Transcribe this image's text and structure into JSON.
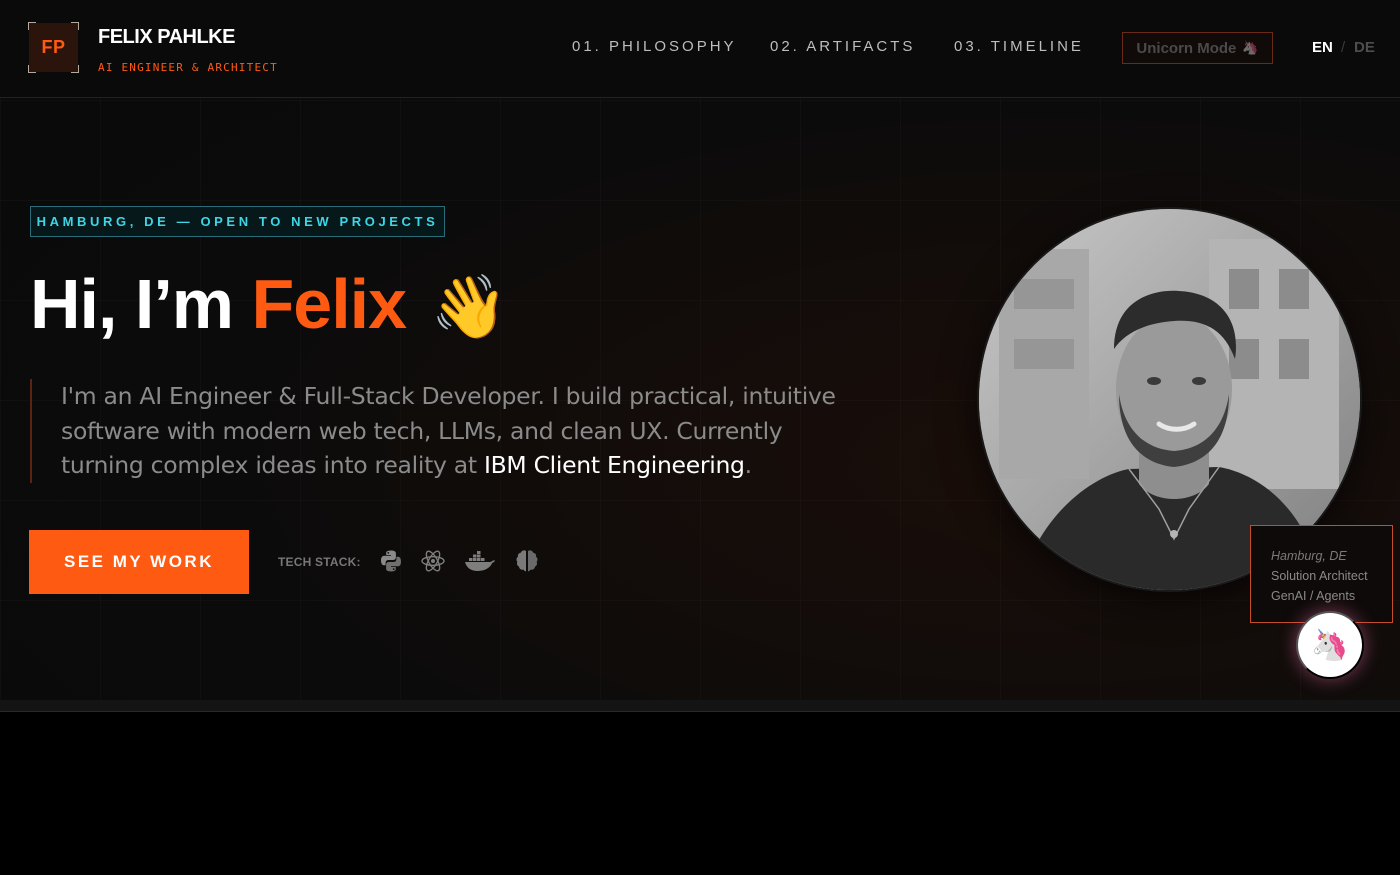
{
  "header": {
    "logo_initials": "FP",
    "brand_name": "FELIX PAHLKE",
    "brand_subtitle": "AI ENGINEER & ARCHITECT",
    "nav": [
      {
        "label": "01. PHILOSOPHY"
      },
      {
        "label": "02. ARTIFACTS"
      },
      {
        "label": "03. TIMELINE"
      }
    ],
    "unicorn_toggle": {
      "label": "Unicorn Mode",
      "icon": "unicorn-icon"
    },
    "languages": {
      "active": "EN",
      "separator": "/",
      "other": "DE"
    }
  },
  "hero": {
    "status_badge": "HAMBURG, DE — OPEN TO NEW PROJECTS",
    "greeting": "Hi, I’m",
    "name": "Felix",
    "wave_emoji": "👋",
    "intro_text": "I'm an AI Engineer & Full-Stack Developer. I build practical, intuitive software with modern web tech, LLMs, and clean UX. Currently turning complex ideas into reality at",
    "intro_highlight": "IBM Client Engineering",
    "intro_end": ".",
    "cta_label": "SEE MY WORK",
    "tech_stack_label": "TECH STACK:",
    "tech_stack_icons": [
      "python-icon",
      "react-icon",
      "docker-icon",
      "brain-icon"
    ]
  },
  "profile_card": {
    "location": "Hamburg, DE",
    "role": "Solution Architect",
    "focus": "GenAI / Agents"
  },
  "floating_button": {
    "emoji": "🦄",
    "icon": "unicorn-icon"
  },
  "colors": {
    "accent": "#ff5a12",
    "cyan": "#3dd6e6",
    "background": "#0a0a0a"
  }
}
